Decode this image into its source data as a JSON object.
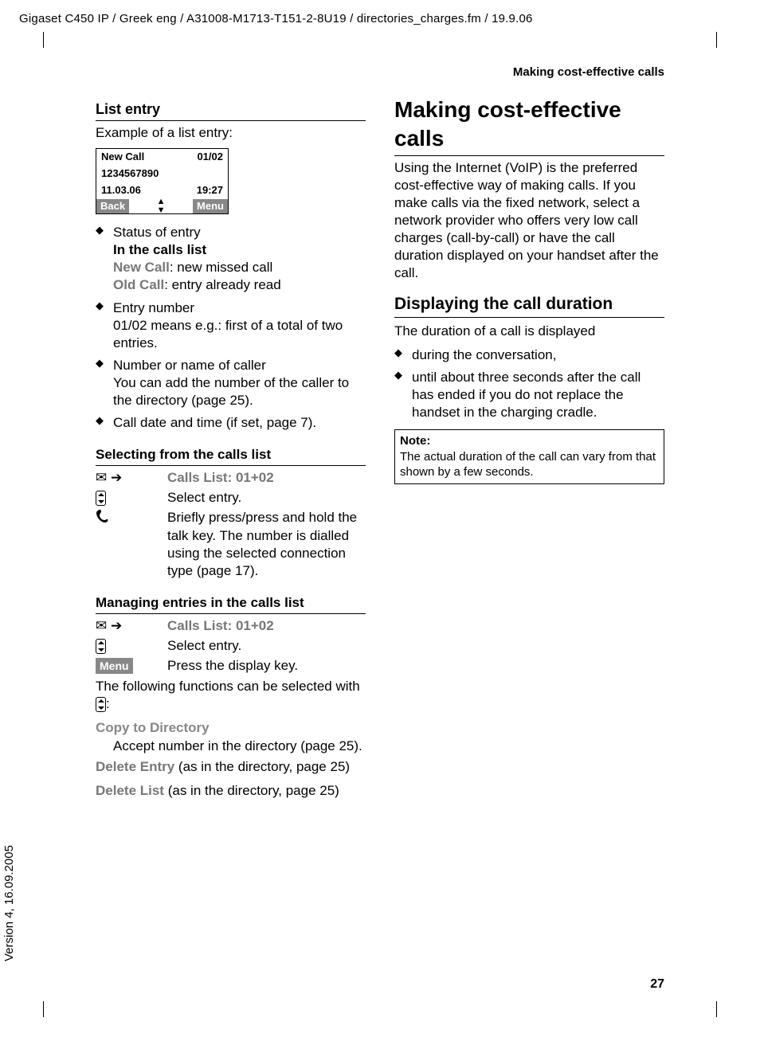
{
  "header": "Gigaset C450 IP / Greek eng / A31008-M1713-T151-2-8U19 / directories_charges.fm / 19.9.06",
  "running_head": "Making cost-effective calls",
  "side": "Version 4, 16.09.2005",
  "pagenum": "27",
  "left": {
    "h3": "List entry",
    "intro": "Example of a list entry:",
    "display": {
      "r1a": "New Call",
      "r1b": "01/02",
      "r2": "1234567890",
      "r3a": "11.03.06",
      "r3b": "19:27",
      "sk_left": "Back",
      "sk_right": "Menu"
    },
    "b1a": "Status of entry",
    "b1b": "In the calls list",
    "b1c": "New Call",
    "b1c2": ": new missed call",
    "b1d": "Old Call",
    "b1d2": ": entry already read",
    "b2a": "Entry number",
    "b2b": "01/02 means e.g.: first of a total of two entries.",
    "b3a": "Number or name of caller",
    "b3b": "You can add the number of the caller to the directory (page 25).",
    "b4": "Call date and time (if set, page 7).",
    "h4a": "Selecting from the calls list",
    "nav1": "Calls List: 01+02",
    "sel": "Select entry.",
    "talk": "Briefly press/press and hold the talk key. The number is dialled using the selected connection type (page 17).",
    "h4b": "Managing entries in the calls list",
    "nav2": "Calls List: 01+02",
    "sel2": "Select entry.",
    "press": "Press the display key.",
    "follow": "The following functions can be selected with ",
    "follow_colon": ":",
    "cd": "Copy to Directory",
    "cd_t": "Accept number in the directory (page 25).",
    "de": "Delete Entry",
    "de_t": " (as in the directory, page 25)",
    "dl": "Delete List",
    "dl_t": " (as in the directory, page 25)"
  },
  "right": {
    "h1": "Making cost-effective calls",
    "p1": "Using the Internet (VoIP) is the preferred cost-effective way of making calls. If you make calls via the fixed network, select a network provider who offers very low call charges (call-by-call) or have the call duration displayed on your handset after the call.",
    "h2": "Displaying the call duration",
    "p2": "The duration of a call is displayed",
    "b1": "during the conversation,",
    "b2": "until about three seconds after the call has ended if you do not replace the handset in the charging cradle.",
    "note_h": "Note:",
    "note_t": "The actual duration of the call can vary from that shown by a few seconds."
  }
}
